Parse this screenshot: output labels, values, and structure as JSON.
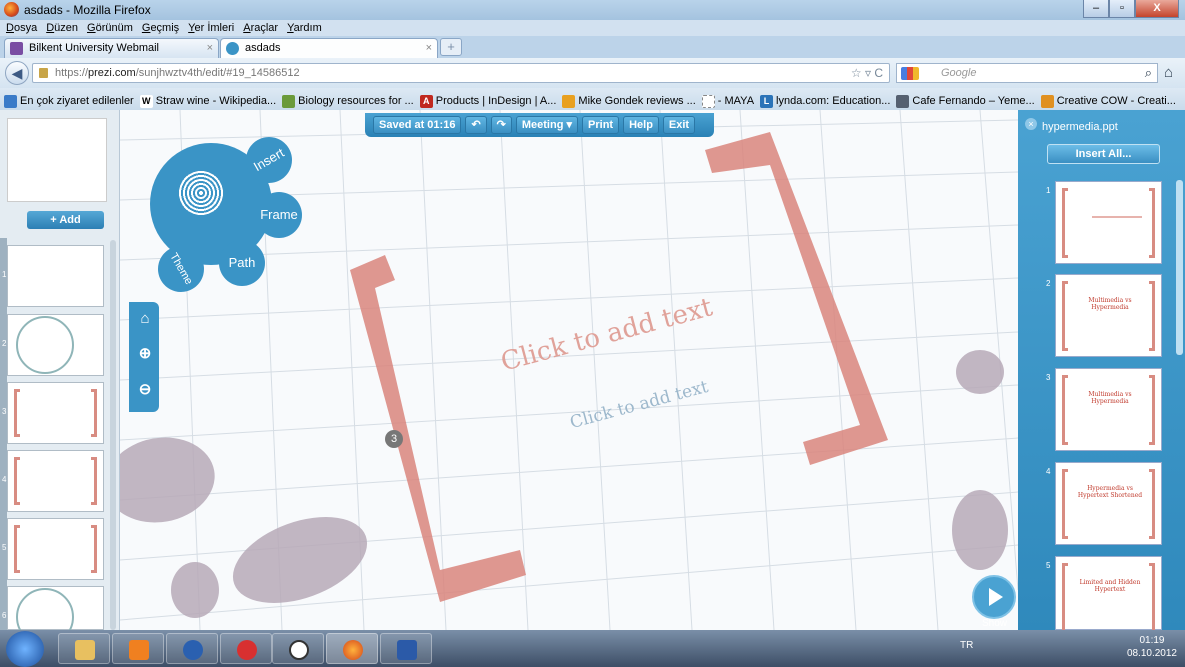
{
  "window": {
    "title": "asdads - Mozilla Firefox",
    "controls": [
      "–",
      "▫",
      "X"
    ]
  },
  "menu": [
    "Dosya",
    "Düzen",
    "Görünüm",
    "Geçmiş",
    "Yer İmleri",
    "Araçlar",
    "Yardım"
  ],
  "tabs": [
    {
      "label": "Bilkent University Webmail",
      "active": false,
      "close": "×"
    },
    {
      "label": "asdads",
      "active": true,
      "close": "×"
    }
  ],
  "newtab": "+",
  "nav": {
    "url_domain": "prezi.com",
    "url_prefix": "https://",
    "url_path": "/sunjhwztv4th/edit/#19_14586512",
    "search_placeholder": "Google"
  },
  "bookmarks": [
    {
      "label": "En çok ziyaret edilenler",
      "color": "#3a7bc8",
      "glyph": ""
    },
    {
      "label": "Straw wine - Wikipedia...",
      "color": "#ffffff",
      "glyph": "W"
    },
    {
      "label": "Biology resources for ...",
      "color": "#6a9a3a",
      "glyph": ""
    },
    {
      "label": "Products | InDesign | A...",
      "color": "#c0281e",
      "glyph": "A"
    },
    {
      "label": "Mike Gondek reviews ...",
      "color": "#e8a020",
      "glyph": ""
    },
    {
      "label": "- MAYA",
      "color": "#ffffff",
      "glyph": ""
    },
    {
      "label": "lynda.com: Education...",
      "color": "#2a73b8",
      "glyph": "L"
    },
    {
      "label": "Cafe Fernando – Yeme...",
      "color": "#556070",
      "glyph": ""
    },
    {
      "label": "Creative COW - Creati...",
      "color": "#e09020",
      "glyph": ""
    }
  ],
  "toolbar": {
    "saved": "Saved at 01:16",
    "undo": "↶",
    "redo": "↷",
    "meeting": "Meeting ▾",
    "print": "Print",
    "help": "Help",
    "exit": "Exit"
  },
  "left_panel": {
    "add": "+ Add",
    "slides": [
      {
        "num": "1"
      },
      {
        "num": "2"
      },
      {
        "num": "3"
      },
      {
        "num": "4"
      },
      {
        "num": "5"
      },
      {
        "num": "6"
      }
    ]
  },
  "zebra": {
    "insert": "Insert",
    "frame": "Frame",
    "path": "Path",
    "theme": "Theme"
  },
  "canvas": {
    "title_placeholder": "Click to add text",
    "body_placeholder": "Click to add text",
    "path_number": "3",
    "bracket_color": "#d9857c"
  },
  "right_panel": {
    "title": "hypermedia.ppt",
    "insert_all": "Insert All...",
    "slides": [
      {
        "num": "1",
        "title": ""
      },
      {
        "num": "2",
        "title": "Multimedia vs Hypermedia"
      },
      {
        "num": "3",
        "title": "Multimedia vs Hypermedia"
      },
      {
        "num": "4",
        "title": "Hypermedia vs Hypertext Shortened"
      },
      {
        "num": "5",
        "title": "Limited and Hidden Hypertext"
      }
    ]
  },
  "show": {
    "label": "Show"
  },
  "taskbar": {
    "lang": "TR",
    "time": "01:19",
    "date": "08.10.2012"
  },
  "colors": {
    "prezi_blue": "#3a94c6",
    "accent_red": "#c0392b"
  }
}
